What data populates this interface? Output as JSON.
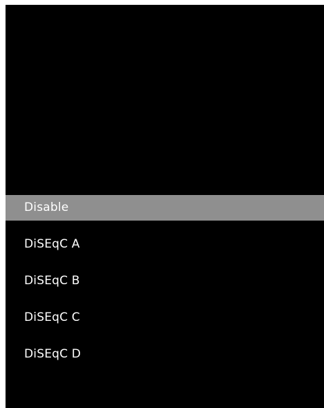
{
  "menu": {
    "selected_index": 0,
    "items": [
      {
        "label": "Disable"
      },
      {
        "label": "DiSEqC A"
      },
      {
        "label": "DiSEqC B"
      },
      {
        "label": "DiSEqC C"
      },
      {
        "label": "DiSEqC D"
      }
    ]
  },
  "colors": {
    "background": "#000000",
    "highlight": "#8f8f8f",
    "text": "#ffffff"
  }
}
